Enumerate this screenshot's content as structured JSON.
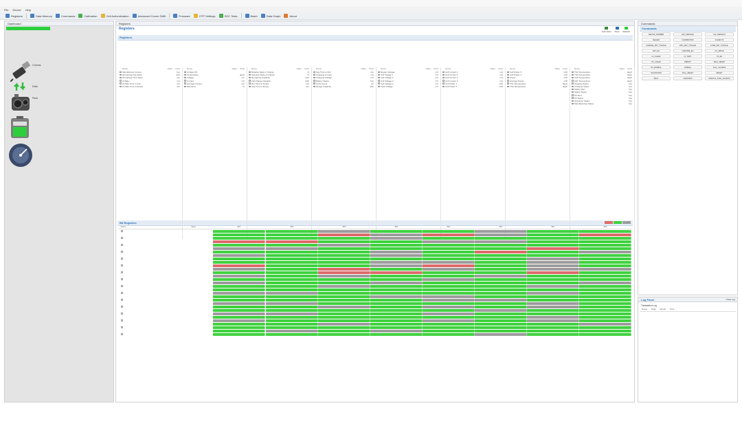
{
  "window": {
    "title": ""
  },
  "menu": [
    "File",
    "Device",
    "Help"
  ],
  "toolbar": [
    {
      "label": "Registers",
      "icon": "grid-icon",
      "color": "#4a7fc1"
    },
    {
      "label": "Data Memory",
      "icon": "memory-icon",
      "color": "#4a7fc1"
    },
    {
      "label": "Commands",
      "icon": "command-icon",
      "color": "#4a7fc1"
    },
    {
      "label": "Calibration",
      "icon": "calibration-icon",
      "color": "#4caf50"
    },
    {
      "label": "Cell Authentication",
      "icon": "key-icon",
      "color": "#e5b53a"
    },
    {
      "label": "Advanced Comm SMB",
      "icon": "bus-icon",
      "color": "#4a7fc1"
    },
    {
      "label": "Firmware",
      "icon": "chip-icon",
      "color": "#4a7fc1"
    },
    {
      "label": "OTP Settings",
      "icon": "otp-icon",
      "color": "#e5b53a"
    },
    {
      "label": "SOC Tests",
      "icon": "test-icon",
      "color": "#4caf50"
    },
    {
      "label": "Batch",
      "icon": "batch-icon",
      "color": "#4a7fc1"
    },
    {
      "label": "Data Graph",
      "icon": "graph-icon",
      "color": "#4a7fc1"
    },
    {
      "label": "About",
      "icon": "info-icon",
      "color": "#e07a2e"
    }
  ],
  "dashboard": {
    "tab": "Dashboard",
    "status": "",
    "subtitle": "",
    "comm_label": "Comms",
    "comm_value": "",
    "arrows_label": "Data",
    "pack_label": "Pack",
    "pack_lines": [
      "",
      "",
      ""
    ],
    "battery_label": "",
    "gauge_label": ""
  },
  "registers": {
    "tab": "Registers",
    "title": "Registers",
    "section": "Registers",
    "toolbar_buttons": [
      "Auto Scan",
      "Scan",
      "Refresh"
    ],
    "columns": [
      "Name",
      "Value",
      "Units"
    ],
    "tables": [
      {
        "rows": [
          [
            "Manufacturer Access",
            "",
            "hex"
          ],
          [
            "Remaining Cap Alarm",
            "",
            "mAh"
          ],
          [
            "Remaining Time Alarm",
            "",
            "min"
          ],
          [
            "At Rate",
            "",
            "mA"
          ],
          [
            "At Rate Time to Full",
            "",
            "min"
          ],
          [
            "At Rate Time to Empty",
            "",
            "min"
          ]
        ]
      },
      {
        "rows": [
          [
            "At Rate OK",
            "",
            ""
          ],
          [
            "Temperature",
            "",
            "degC"
          ],
          [
            "Voltage",
            "",
            "mV"
          ],
          [
            "Current",
            "",
            "mA"
          ],
          [
            "Average Current",
            "",
            "mA"
          ],
          [
            "Max Error",
            "",
            "%"
          ]
        ]
      },
      {
        "rows": [
          [
            "Relative State of Charge",
            "",
            "%"
          ],
          [
            "Absolute State of Charge",
            "",
            "%"
          ],
          [
            "Remaining Capacity",
            "",
            "mAh"
          ],
          [
            "Full Charge Capacity",
            "",
            "mAh"
          ],
          [
            "Run Time to Empty",
            "",
            "min"
          ],
          [
            "Avg Time to Empty",
            "",
            "min"
          ]
        ]
      },
      {
        "rows": [
          [
            "Avg Time to Full",
            "",
            "min"
          ],
          [
            "Charging Current",
            "",
            "mA"
          ],
          [
            "Charging Voltage",
            "",
            "mV"
          ],
          [
            "Battery Status",
            "",
            "hex"
          ],
          [
            "Cycle Count",
            "",
            "cnt"
          ],
          [
            "Design Capacity",
            "",
            "mAh"
          ]
        ]
      },
      {
        "rows": [
          [
            "Design Voltage",
            "",
            "mV"
          ],
          [
            "Cell Voltage 1",
            "",
            "mV"
          ],
          [
            "Cell Voltage 2",
            "",
            "mV"
          ],
          [
            "Cell Voltage 3",
            "",
            "mV"
          ],
          [
            "Cell Voltage 4",
            "",
            "mV"
          ],
          [
            "Pack Voltage",
            "",
            "mV"
          ]
        ]
      },
      {
        "rows": [
          [
            "Cell Current 1",
            "",
            "mA"
          ],
          [
            "Cell Current 2",
            "",
            "mA"
          ],
          [
            "Cell Current 3",
            "",
            "mA"
          ],
          [
            "Cell Current 4",
            "",
            "mA"
          ],
          [
            "Cell Power 1",
            "",
            "mW"
          ],
          [
            "Cell Power 2",
            "",
            "mW"
          ]
        ]
      },
      {
        "rows": [
          [
            "Cell Power 3",
            "",
            "mW"
          ],
          [
            "Cell Power 4",
            "",
            "mW"
          ],
          [
            "Power",
            "",
            "mW"
          ],
          [
            "Average Power",
            "",
            "mW"
          ],
          [
            "TS1 Temperature",
            "",
            "degC"
          ],
          [
            "TS2 Temperature",
            "",
            "degC"
          ]
        ]
      },
      {
        "rows": [
          [
            "TS3 Temperature",
            "",
            "degC"
          ],
          [
            "TS4 Temperature",
            "",
            "degC"
          ],
          [
            "Cell Temperature",
            "",
            "degC"
          ],
          [
            "FET Temperature",
            "",
            "degC"
          ],
          [
            "Gauging Status",
            "",
            "hex"
          ],
          [
            "Charging Status",
            "",
            "hex"
          ],
          [
            "Safety Alert",
            "",
            "hex"
          ],
          [
            "Safety Status",
            "",
            "hex"
          ],
          [
            "PF Alert",
            "",
            "hex"
          ],
          [
            "PF Status",
            "",
            "hex"
          ],
          [
            "Operation Status",
            "",
            "hex"
          ],
          [
            "Manufacturing Status",
            "",
            "hex"
          ]
        ]
      }
    ]
  },
  "bit_registers": {
    "section": "Bit Registers",
    "columns": [
      "Name",
      "Value",
      "Bit7",
      "Bit6",
      "Bit5",
      "Bit4",
      "Bit3",
      "Bit2",
      "Bit1",
      "Bit0"
    ],
    "legend_colors": [
      "#dd6a6a",
      "#3fd23f",
      "#9c9c9c"
    ]
  },
  "commands": {
    "tab": "Commands",
    "section": "Commands",
    "buttons": [
      "DEVICE_NUMBER",
      "HW_VERSION",
      "FW_VERSION",
      "SEALED",
      "CALIBRATION",
      "CLEAR PF",
      "CHARGE_FET_TOGGLE",
      "DSG_FET_TOGGLE",
      "FUSE_FET_TOGGLE",
      "FET_EN",
      "LIFETIME_EN",
      "CC_DRIVE",
      "LF_CLEAR",
      "LT_TEST",
      "TS_EN",
      "PF_CLEAR",
      "PERMIT",
      "SEAL_RESET",
      "PF_ENABLE",
      "UNSEAL",
      "FULL_ACCESS",
      "SHUTDOWN",
      "FULL_RESET",
      "RESET",
      "SEAL",
      "CHEKSUM",
      "MANUAL_FUEL_ACCESS"
    ]
  },
  "log": {
    "tab": "Log Panel",
    "section": "Transaction Log",
    "clear": "Clear Log",
    "columns": [
      "Name",
      "Data",
      "Result",
      "Time"
    ]
  }
}
